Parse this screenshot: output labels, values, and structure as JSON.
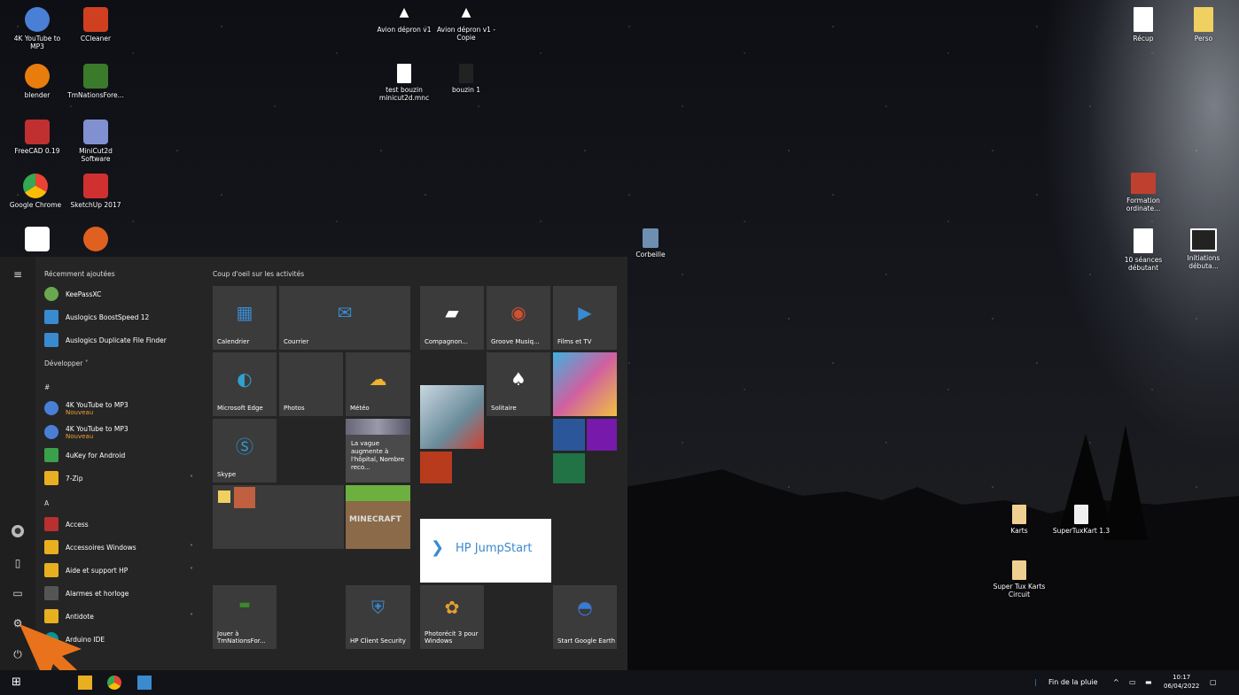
{
  "desktop": {
    "left_icons": [
      {
        "label": "4K YouTube to MP3",
        "color": "#4a7fd6"
      },
      {
        "label": "CCleaner",
        "color": "#d04020"
      },
      {
        "label": "blender",
        "color": "#e87d0d"
      },
      {
        "label": "TmNationsFore...",
        "color": "#3a7a2a"
      },
      {
        "label": "FreeCAD 0.19",
        "color": "#c03030"
      },
      {
        "label": "MiniCut2d Software",
        "color": "#8090d0"
      },
      {
        "label": "Google Chrome",
        "color": "#4285f4"
      },
      {
        "label": "SketchUp 2017",
        "color": "#d03030"
      }
    ],
    "top_icons": [
      {
        "label": "Avion dépron v1"
      },
      {
        "label": "Avion dépron v1 - Copie"
      },
      {
        "label": "test bouzin minicut2d.mnc"
      },
      {
        "label": "bouzin 1"
      }
    ],
    "recycle_bin": "Corbeille",
    "right_icons": [
      {
        "label": "Récup"
      },
      {
        "label": "Perso"
      },
      {
        "label": "Formation ordinate..."
      },
      {
        "label": "10 séances débutant"
      },
      {
        "label": "Initiations débuta..."
      },
      {
        "label": "Karts"
      },
      {
        "label": "SuperTuxKart 1.3"
      },
      {
        "label": "Super Tux Karts Circuit"
      }
    ]
  },
  "start_menu": {
    "recent_header": "Récemment ajoutées",
    "recent": [
      {
        "label": "KeePassXC",
        "color": "#6aa84f"
      },
      {
        "label": "Auslogics BoostSpeed 12",
        "color": "#3a8ad0"
      },
      {
        "label": "Auslogics Duplicate File Finder",
        "color": "#3a8ad0"
      }
    ],
    "expand": "Développer",
    "hash_header": "#",
    "hash_apps": [
      {
        "label": "4K YouTube to MP3",
        "sub": "Nouveau",
        "color": "#4a7fd6"
      },
      {
        "label": "4K YouTube to MP3",
        "sub": "Nouveau",
        "color": "#4a7fd6"
      },
      {
        "label": "4uKey for Android",
        "sub": "",
        "color": "#3aa04a"
      },
      {
        "label": "7-Zip",
        "sub": "",
        "color": "#e8b020"
      }
    ],
    "a_header": "A",
    "a_apps": [
      {
        "label": "Access",
        "color": "#b83030"
      },
      {
        "label": "Accessoires Windows",
        "color": "#e8b020"
      },
      {
        "label": "Aide et support HP",
        "color": "#e8b020"
      },
      {
        "label": "Alarmes et horloge",
        "color": "#555"
      },
      {
        "label": "Antidote",
        "color": "#e8b020"
      },
      {
        "label": "Arduino IDE",
        "color": "#00979c"
      }
    ],
    "tiles_header": "Coup d'oeil sur les activités",
    "tiles": {
      "calendrier": "Calendrier",
      "courrier": "Courrier",
      "compagnon": "Compagnon...",
      "groove": "Groove Musiq...",
      "films": "Films et TV",
      "edge": "Microsoft Edge",
      "photos": "Photos",
      "meteo": "Météo",
      "solitaire": "Solitaire",
      "skype": "Skype",
      "news": "La vague augmente à l'hôpital, Nombre reco...",
      "minecraft": "MINECRAFT",
      "hp_jumpstart": "HP JumpStart",
      "jouer": "Jouer à TmNationsFor...",
      "hp_client": "HP Client Security",
      "photorecit": "Photorécit 3 pour Windows",
      "google_earth": "Start Google Earth"
    }
  },
  "taskbar": {
    "weather": "Fin de la pluie",
    "time": "10:17",
    "date": "06/04/2022"
  }
}
